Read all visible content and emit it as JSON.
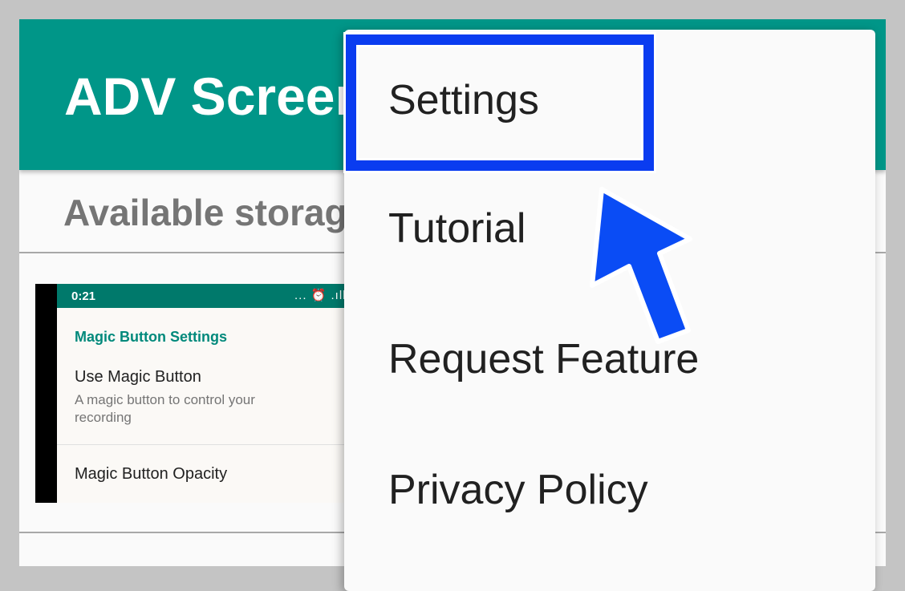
{
  "app": {
    "title": "ADV Screen",
    "storage_label": "Available storage"
  },
  "thumbnail": {
    "status_time": "0:21",
    "status_icons": "... ⏰ .ıll",
    "section_header": "Magic Button Settings",
    "pref_title": "Use Magic Button",
    "pref_summary": "A magic button to control your recording",
    "opacity_title": "Magic Button Opacity"
  },
  "menu": {
    "items": [
      {
        "label": "Settings"
      },
      {
        "label": "Tutorial"
      },
      {
        "label": "Request Feature"
      },
      {
        "label": "Privacy Policy"
      }
    ]
  },
  "colors": {
    "app_bar": "#009688",
    "highlight": "#0a3cf0",
    "arrow": "#0a4cf5"
  }
}
